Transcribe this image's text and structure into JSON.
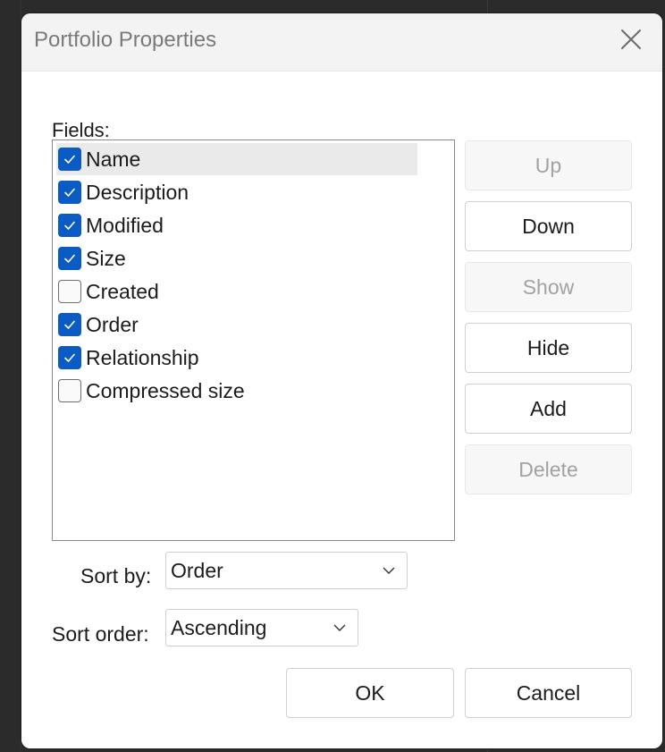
{
  "dialog": {
    "title": "Portfolio Properties",
    "close_icon": "close-icon"
  },
  "fields": {
    "label": "Fields:",
    "items": [
      {
        "label": "Name",
        "checked": true,
        "selected": true
      },
      {
        "label": "Description",
        "checked": true,
        "selected": false
      },
      {
        "label": "Modified",
        "checked": true,
        "selected": false
      },
      {
        "label": "Size",
        "checked": true,
        "selected": false
      },
      {
        "label": "Created",
        "checked": false,
        "selected": false
      },
      {
        "label": "Order",
        "checked": true,
        "selected": false
      },
      {
        "label": "Relationship",
        "checked": true,
        "selected": false
      },
      {
        "label": "Compressed size",
        "checked": false,
        "selected": false
      }
    ]
  },
  "buttons": {
    "up": {
      "label": "Up",
      "enabled": false
    },
    "down": {
      "label": "Down",
      "enabled": true
    },
    "show": {
      "label": "Show",
      "enabled": false
    },
    "hide": {
      "label": "Hide",
      "enabled": true
    },
    "add": {
      "label": "Add",
      "enabled": true
    },
    "delete": {
      "label": "Delete",
      "enabled": false
    }
  },
  "sort_by": {
    "label": "Sort by:",
    "value": "Order"
  },
  "sort_order": {
    "label": "Sort order:",
    "value": "Ascending"
  },
  "footer": {
    "ok_label": "OK",
    "cancel_label": "Cancel"
  },
  "colors": {
    "checkbox_checked": "#0a5bc4",
    "selected_row": "#eaeaea"
  }
}
